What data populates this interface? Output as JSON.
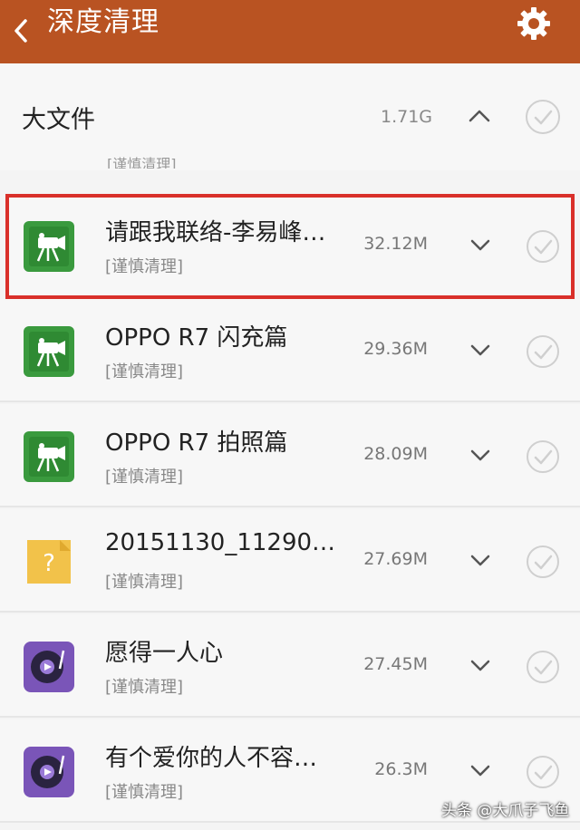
{
  "header": {
    "title": "深度清理",
    "back_icon": "back-arrow-icon",
    "settings_icon": "gear-icon"
  },
  "section": {
    "title": "大文件",
    "size": "1.71G",
    "expanded_icon": "chevron-up-icon",
    "peek_tag": "[谨慎清理]"
  },
  "files": [
    {
      "name": "请跟我联络-李易峰…",
      "tag": "[谨慎清理]",
      "size": "32.12M",
      "icon": "video-camera-icon",
      "icon_color": "#3a9a3e",
      "highlighted": true
    },
    {
      "name": "OPPO R7 闪充篇",
      "tag": "[谨慎清理]",
      "size": "29.36M",
      "icon": "video-camera-icon",
      "icon_color": "#3a9a3e",
      "highlighted": false
    },
    {
      "name": "OPPO R7 拍照篇",
      "tag": "[谨慎清理]",
      "size": "28.09M",
      "icon": "video-camera-icon",
      "icon_color": "#3a9a3e",
      "highlighted": false
    },
    {
      "name": "20151130_11290…",
      "tag": "[谨慎清理]",
      "size": "27.69M",
      "icon": "unknown-file-icon",
      "icon_color": "#f2c24a",
      "highlighted": false
    },
    {
      "name": "愿得一人心",
      "tag": "[谨慎清理]",
      "size": "27.45M",
      "icon": "music-disc-icon",
      "icon_color": "#7a55b8",
      "highlighted": false
    },
    {
      "name": "有个爱你的人不容…",
      "tag": "[谨慎清理]",
      "size": "26.3M",
      "icon": "music-disc-icon",
      "icon_color": "#7a55b8",
      "highlighted": false
    }
  ],
  "watermark": "头条 @大爪子飞鱼",
  "colors": {
    "header_bg": "#b95322",
    "highlight_border": "#d9302a"
  }
}
